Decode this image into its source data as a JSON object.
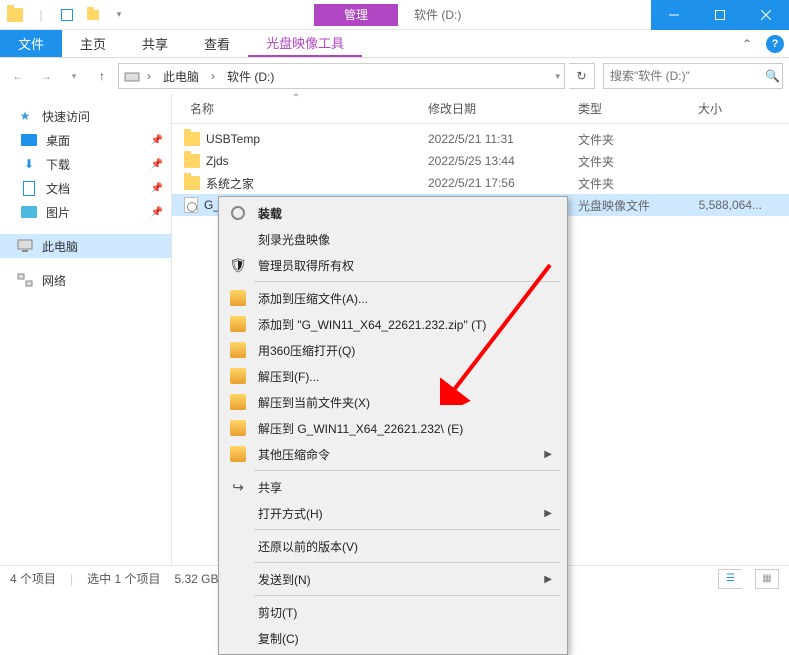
{
  "titlebar": {
    "contextual_tab": "管理",
    "title": "软件 (D:)"
  },
  "ribbon": {
    "file": "文件",
    "tabs": [
      "主页",
      "共享",
      "查看",
      "光盘映像工具"
    ]
  },
  "nav": {
    "breadcrumb": [
      "此电脑",
      "软件 (D:)"
    ],
    "search_placeholder": "搜索\"软件 (D:)\""
  },
  "navpane": {
    "quick_access": "快速访问",
    "desktop": "桌面",
    "downloads": "下载",
    "documents": "文档",
    "pictures": "图片",
    "this_pc": "此电脑",
    "network": "网络"
  },
  "columns": {
    "name": "名称",
    "date": "修改日期",
    "type": "类型",
    "size": "大小"
  },
  "files": [
    {
      "name": "USBTemp",
      "date": "2022/5/21 11:31",
      "type": "文件夹",
      "size": "",
      "kind": "folder"
    },
    {
      "name": "Zjds",
      "date": "2022/5/25 13:44",
      "type": "文件夹",
      "size": "",
      "kind": "folder"
    },
    {
      "name": "系统之家",
      "date": "2022/5/21 17:56",
      "type": "文件夹",
      "size": "",
      "kind": "folder"
    },
    {
      "name": "G_",
      "date": "",
      "type": "光盘映像文件",
      "size": "5,588,064...",
      "kind": "iso",
      "selected": true
    }
  ],
  "context_menu": {
    "mount": "装载",
    "burn": "刻录光盘映像",
    "admin": "管理员取得所有权",
    "add_archive": "添加到压缩文件(A)...",
    "add_zip": "添加到 \"G_WIN11_X64_22621.232.zip\" (T)",
    "open_360": "用360压缩打开(Q)",
    "extract_to": "解压到(F)...",
    "extract_here": "解压到当前文件夹(X)",
    "extract_named": "解压到 G_WIN11_X64_22621.232\\ (E)",
    "other_compress": "其他压缩命令",
    "share": "共享",
    "open_with": "打开方式(H)",
    "restore": "还原以前的版本(V)",
    "send_to": "发送到(N)",
    "cut": "剪切(T)",
    "copy": "复制(C)"
  },
  "statusbar": {
    "items": "4 个项目",
    "selected": "选中 1 个项目",
    "size": "5.32 GB"
  }
}
